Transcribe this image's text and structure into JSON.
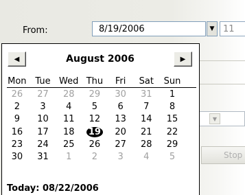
{
  "form": {
    "from_label": "From:",
    "from_date": "8/19/2006",
    "time_value": "11",
    "button_label": "Stop"
  },
  "calendar": {
    "month_title": "August 2006",
    "prev_icon": "triangle-left",
    "next_icon": "triangle-right",
    "days_of_week": [
      "Mon",
      "Tue",
      "Wed",
      "Thu",
      "Fri",
      "Sat",
      "Sun"
    ],
    "weeks": [
      [
        {
          "d": "26",
          "o": true
        },
        {
          "d": "27",
          "o": true
        },
        {
          "d": "28",
          "o": true
        },
        {
          "d": "29",
          "o": true
        },
        {
          "d": "30",
          "o": true
        },
        {
          "d": "31",
          "o": true
        },
        {
          "d": "1",
          "o": false
        }
      ],
      [
        {
          "d": "2",
          "o": false
        },
        {
          "d": "3",
          "o": false
        },
        {
          "d": "4",
          "o": false
        },
        {
          "d": "5",
          "o": false
        },
        {
          "d": "6",
          "o": false
        },
        {
          "d": "7",
          "o": false
        },
        {
          "d": "8",
          "o": false
        }
      ],
      [
        {
          "d": "9",
          "o": false
        },
        {
          "d": "10",
          "o": false
        },
        {
          "d": "11",
          "o": false
        },
        {
          "d": "12",
          "o": false
        },
        {
          "d": "13",
          "o": false
        },
        {
          "d": "14",
          "o": false
        },
        {
          "d": "15",
          "o": false
        }
      ],
      [
        {
          "d": "16",
          "o": false
        },
        {
          "d": "17",
          "o": false
        },
        {
          "d": "18",
          "o": false
        },
        {
          "d": "19",
          "o": false,
          "sel": true
        },
        {
          "d": "20",
          "o": false
        },
        {
          "d": "21",
          "o": false
        },
        {
          "d": "22",
          "o": false
        }
      ],
      [
        {
          "d": "23",
          "o": false
        },
        {
          "d": "24",
          "o": false
        },
        {
          "d": "25",
          "o": false
        },
        {
          "d": "26",
          "o": false
        },
        {
          "d": "27",
          "o": false
        },
        {
          "d": "28",
          "o": false
        },
        {
          "d": "29",
          "o": false
        }
      ],
      [
        {
          "d": "30",
          "o": false
        },
        {
          "d": "31",
          "o": false
        },
        {
          "d": "1",
          "o": true
        },
        {
          "d": "2",
          "o": true
        },
        {
          "d": "3",
          "o": true
        },
        {
          "d": "4",
          "o": true
        },
        {
          "d": "5",
          "o": true
        }
      ]
    ],
    "selected_day": "19",
    "today_text": "Today: 08/22/2006"
  },
  "colors": {
    "dialog_bg": "#ecece6",
    "other_month_text": "#a0a0a0",
    "selected_bg": "#000000"
  }
}
